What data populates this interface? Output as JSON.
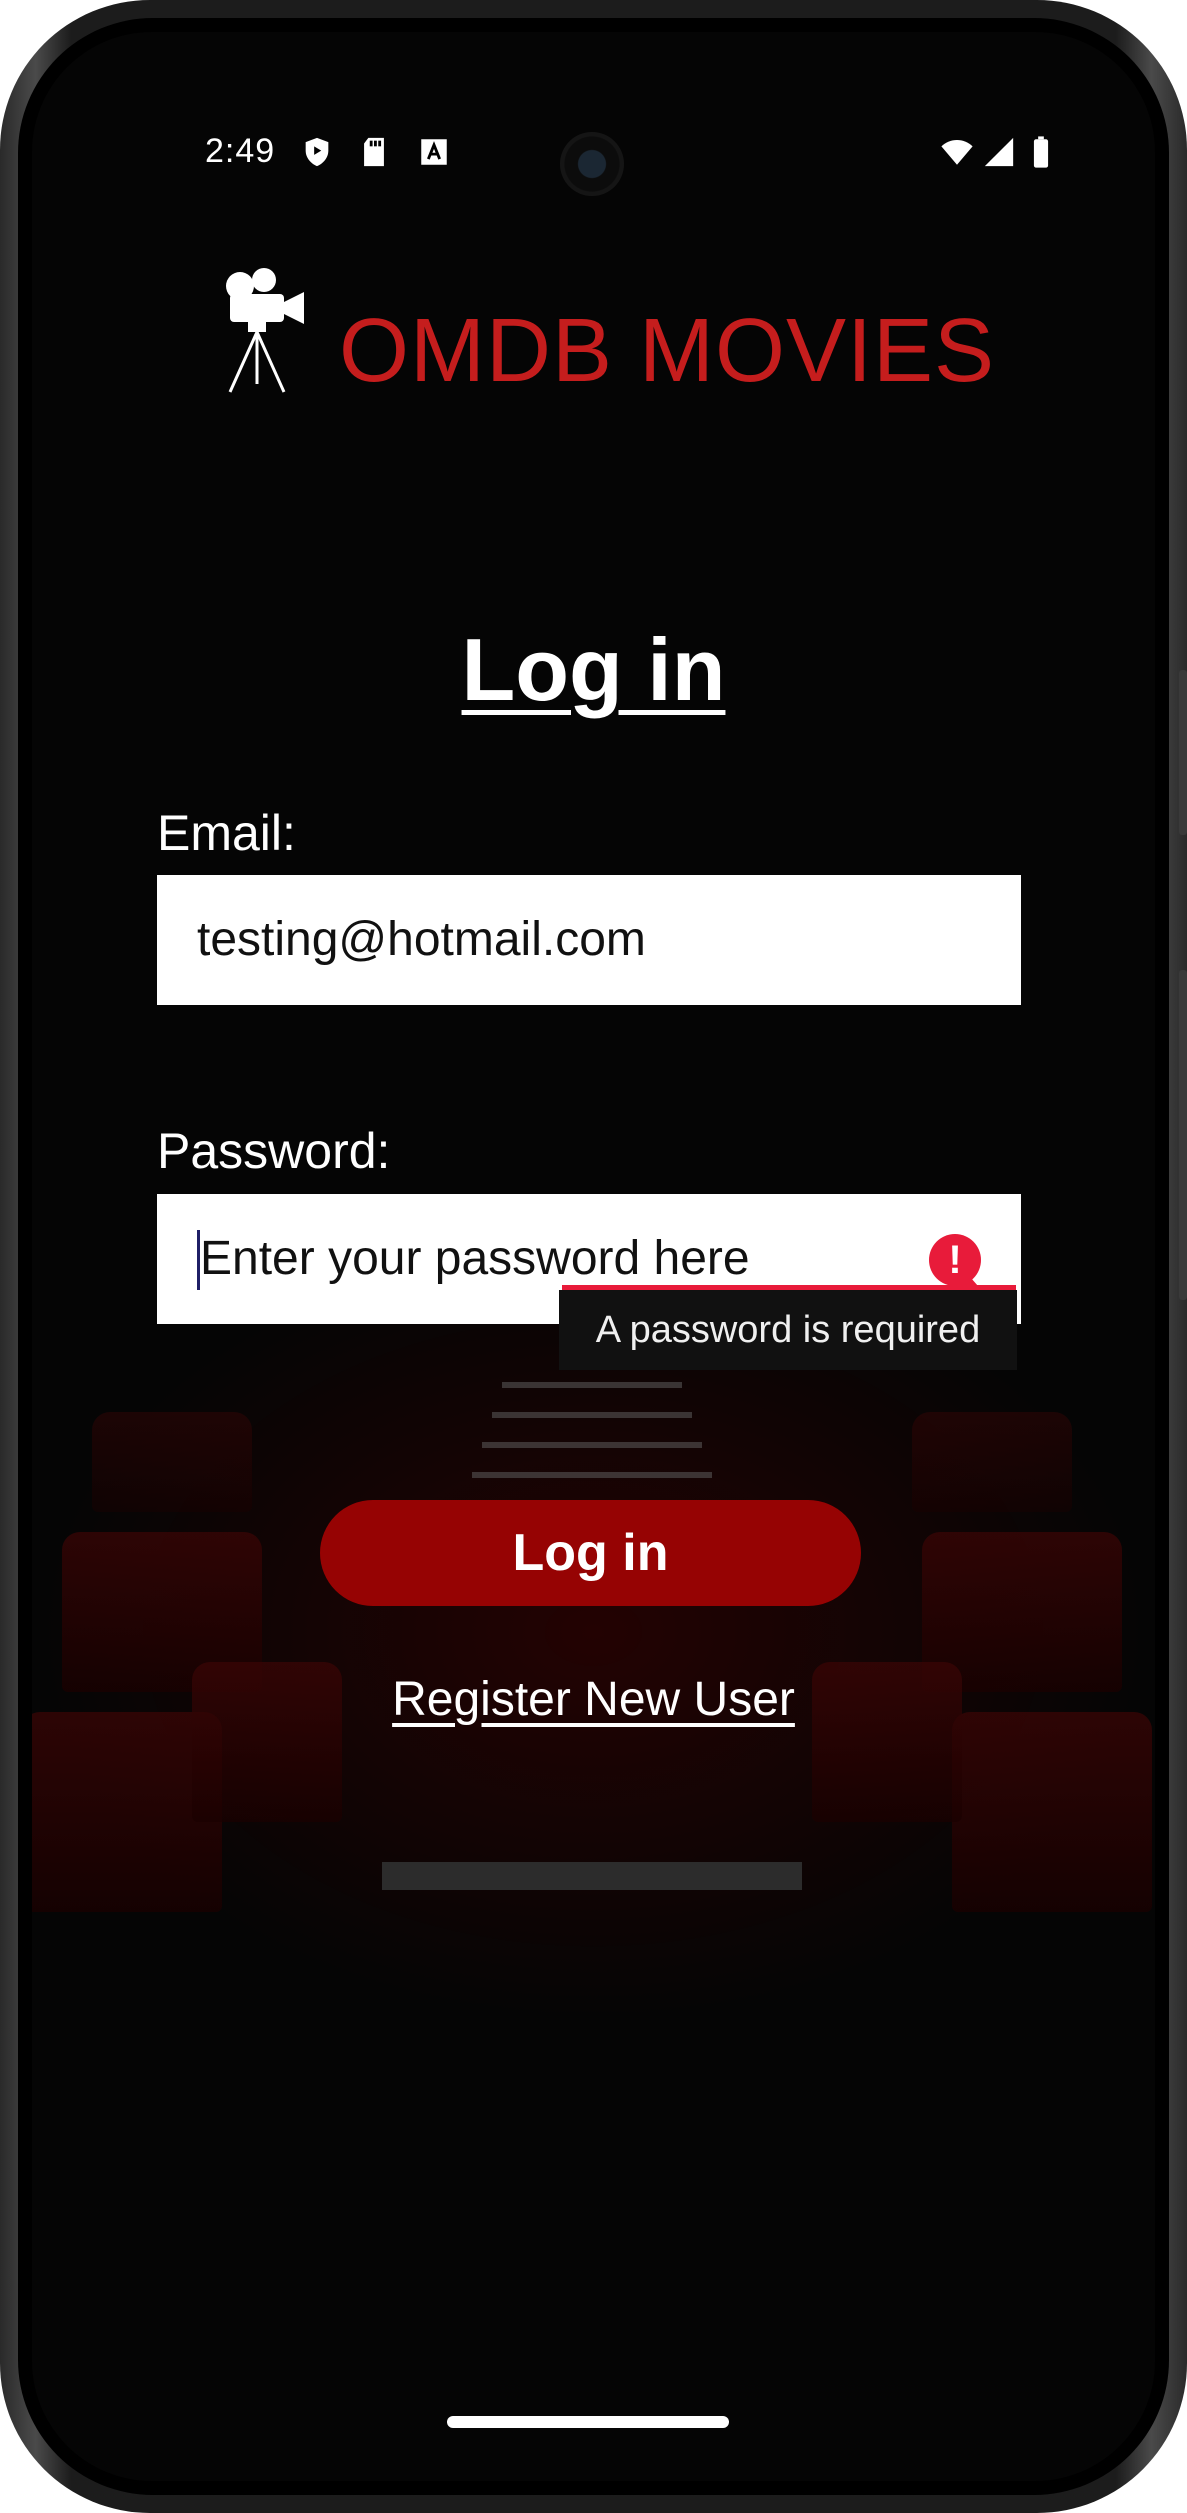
{
  "status_bar": {
    "time": "2:49",
    "icons": [
      "shield-icon",
      "sd-card-icon",
      "font-a-icon",
      "wifi-icon",
      "signal-icon",
      "battery-icon"
    ]
  },
  "app": {
    "title": "OMDB MOVIES",
    "logo_icon": "movie-camera-icon",
    "accent_color": "#c51d1d"
  },
  "login": {
    "heading": "Log in",
    "email_label": "Email:",
    "email_value": "testing@hotmail.com",
    "password_label": "Password:",
    "password_placeholder": "Enter your password here",
    "password_error": "A password is required",
    "login_button": "Log in",
    "register_link": "Register New User",
    "button_color": "#960303",
    "error_color": "#e81b3a"
  }
}
